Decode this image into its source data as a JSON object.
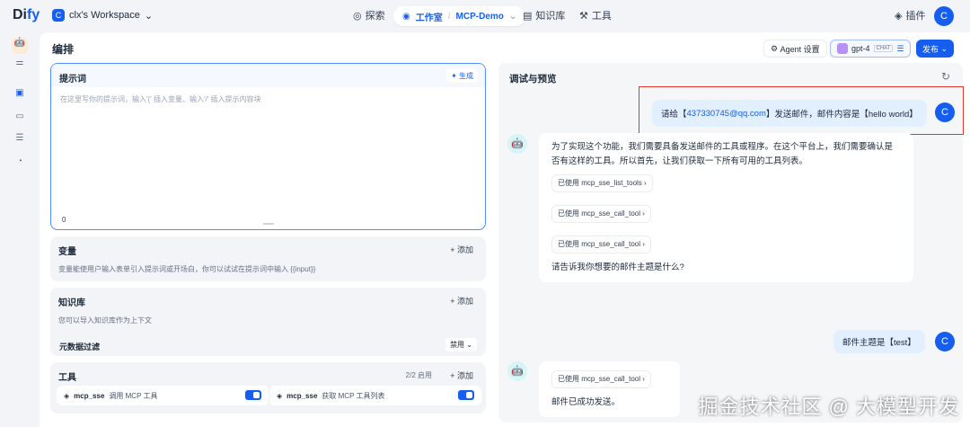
{
  "header": {
    "logo": "Dify",
    "workspace_initial": "C",
    "workspace": "clx's Workspace",
    "nav": {
      "explore": "探索",
      "studio": "工作室",
      "app": "MCP-Demo",
      "knowledge": "知识库",
      "tools": "工具",
      "plugins": "插件"
    },
    "user_initial": "C"
  },
  "toolbar": {
    "title": "编排",
    "agent_settings": "Agent 设置",
    "model": "gpt-4",
    "model_tag": "CHAT",
    "publish": "发布"
  },
  "prompt": {
    "label": "提示词",
    "generate": "生成",
    "placeholder": "在这里写你的提示词，输入'{' 插入变量、输入'/' 插入提示内容块",
    "count": "0"
  },
  "variables": {
    "label": "变量",
    "add": "+ 添加",
    "desc": "变量能使用户输入表单引入提示词或开场白，你可以试试在提示词中输入 {{input}}"
  },
  "knowledge": {
    "label": "知识库",
    "add": "+ 添加",
    "desc": "您可以导入知识库作为上下文",
    "filter_label": "元数据过滤",
    "filter_value": "禁用"
  },
  "tools": {
    "label": "工具",
    "enabled": "2/2 启用",
    "add": "+ 添加",
    "items": [
      {
        "provider": "mcp_sse",
        "name": "调用 MCP 工具",
        "enabled": true
      },
      {
        "provider": "mcp_sse",
        "name": "获取 MCP 工具列表",
        "enabled": true
      }
    ]
  },
  "preview": {
    "title": "调试与预览",
    "msg1_pre": "请给【",
    "msg1_email": "437330745@qq.com",
    "msg1_post": "】发送邮件，邮件内容是【hello world】",
    "reply1": "为了实现这个功能，我们需要具备发送邮件的工具或程序。在这个平台上，我们需要确认是否有这样的工具。所以首先，让我们获取一下所有可用的工具列表。",
    "used1": "已使用 mcp_sse_list_tools ›",
    "used2": "已使用 mcp_sse_call_tool ›",
    "used3": "已使用 mcp_sse_call_tool ›",
    "reply1_end": "请告诉我你想要的邮件主题是什么?",
    "msg2": "邮件主题是【test】",
    "used4": "已使用 mcp_sse_call_tool ›",
    "reply2": "邮件已成功发送。",
    "user_initial": "C"
  },
  "watermark": "掘金技术社区 @ 大模型开发"
}
